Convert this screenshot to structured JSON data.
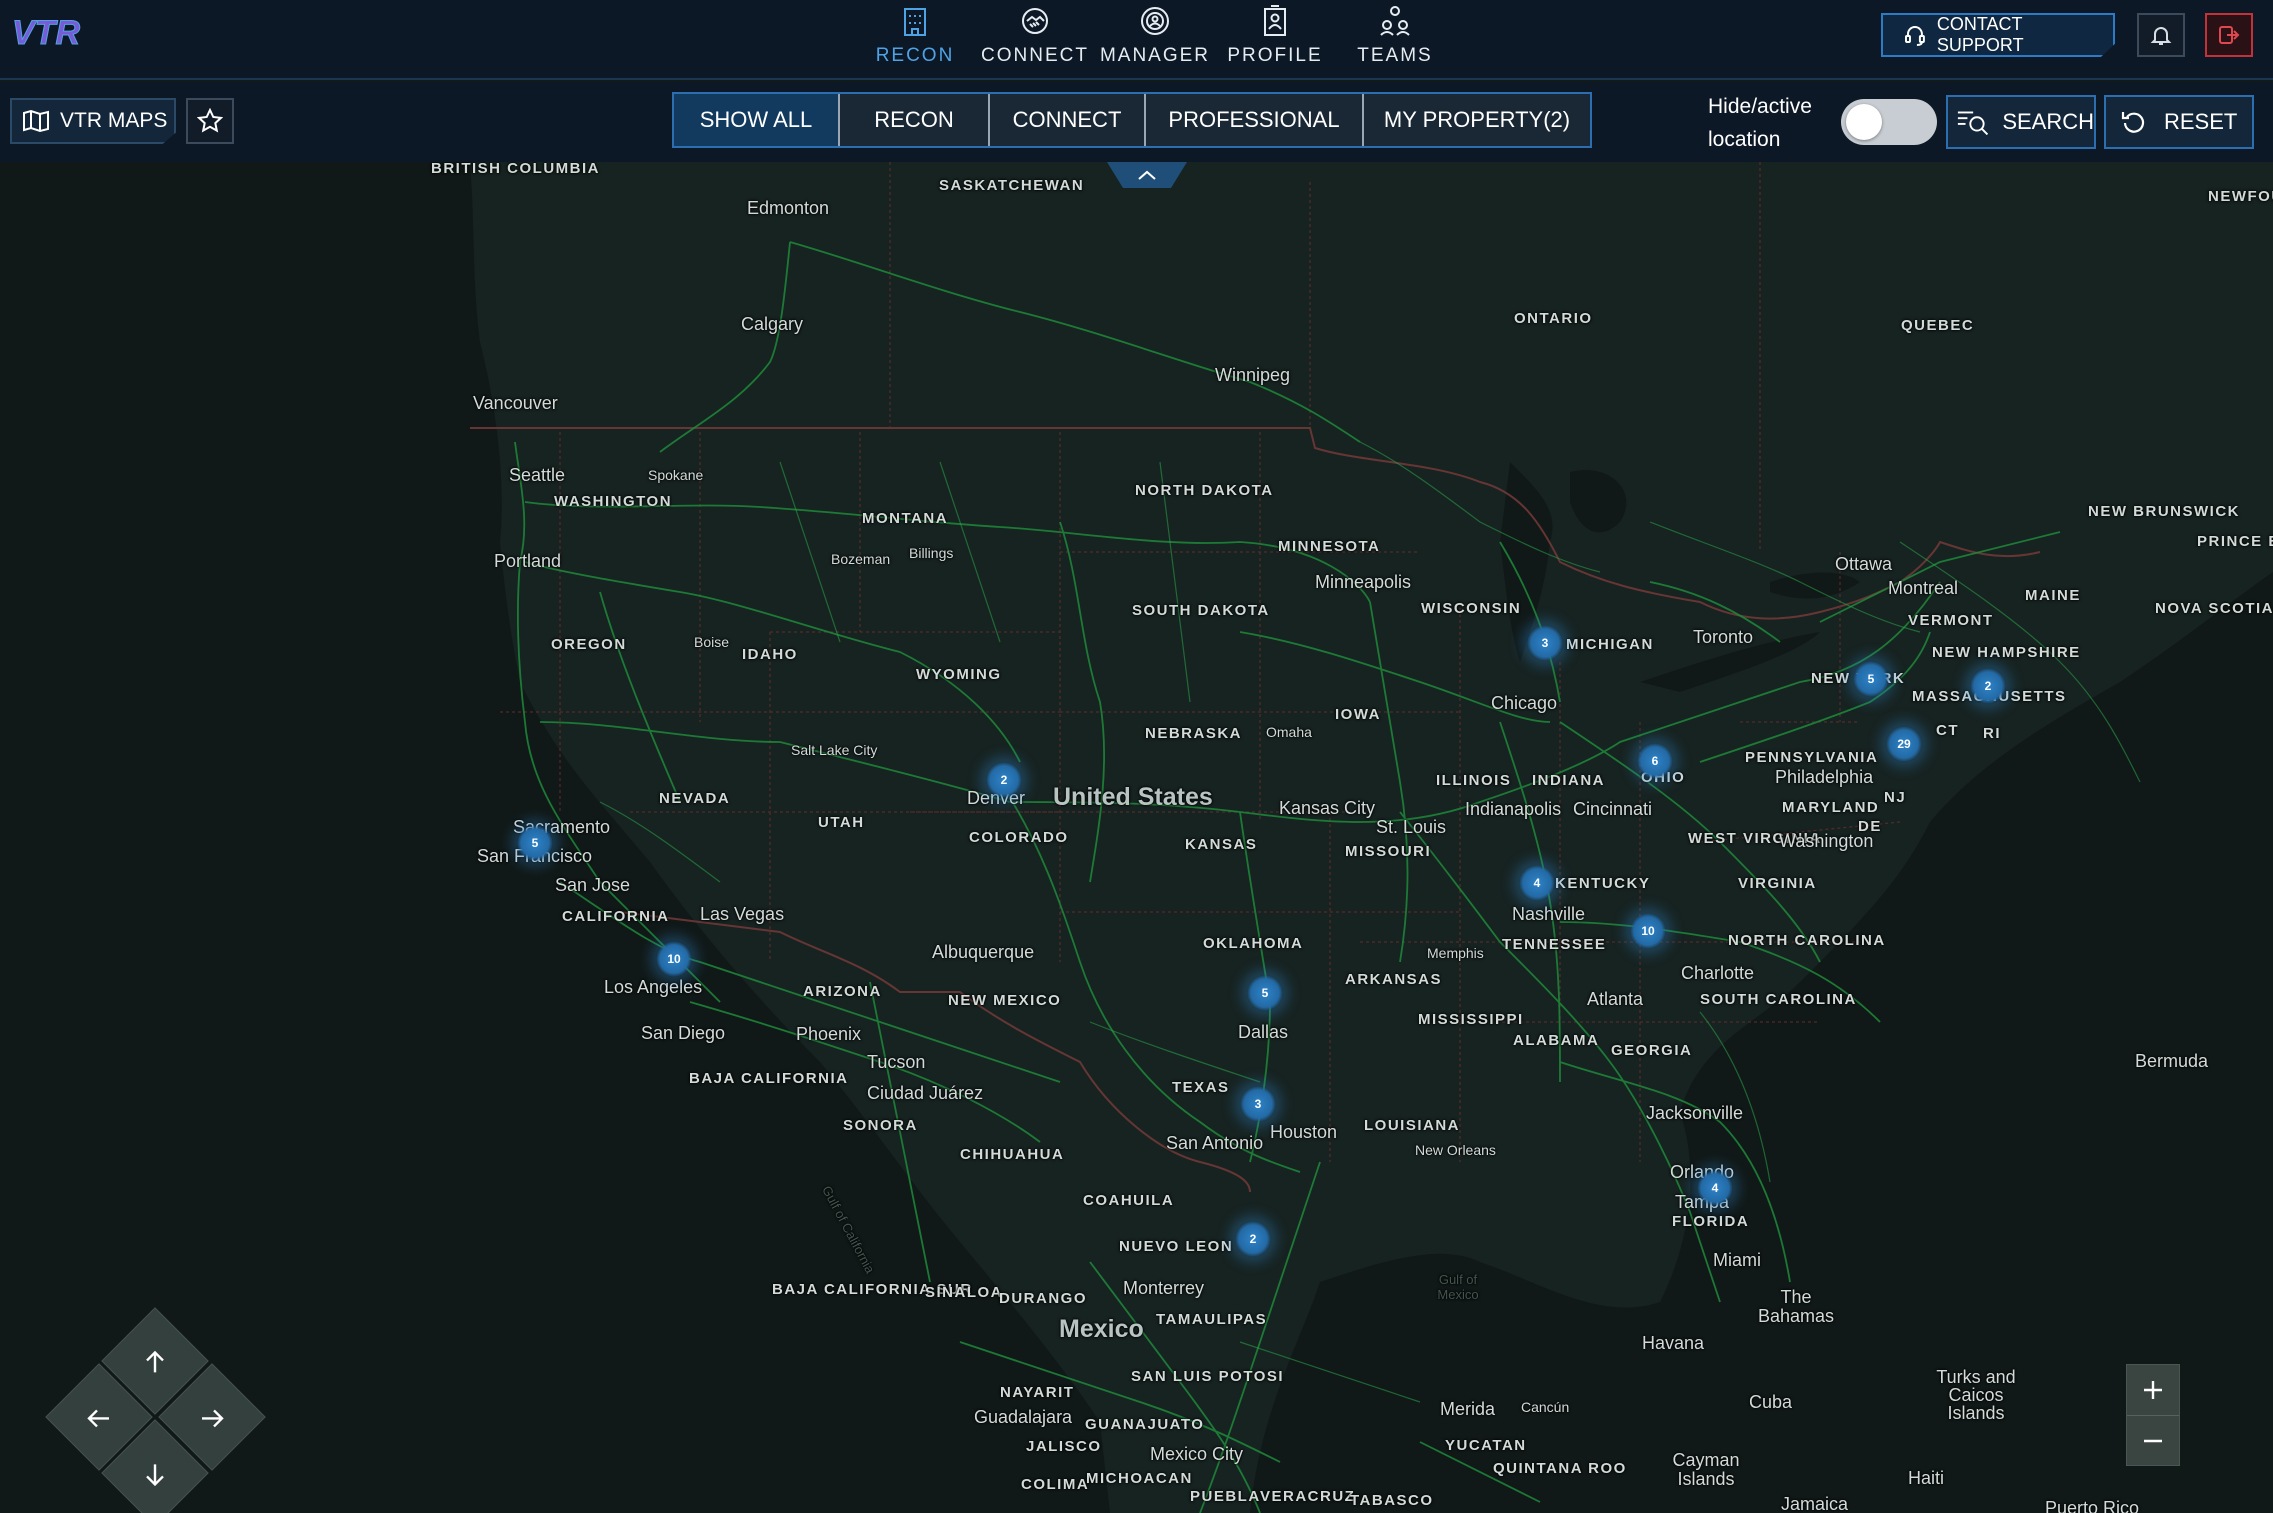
{
  "app": {
    "logo_text": "VTR"
  },
  "topnav": {
    "items": [
      {
        "label": "RECON",
        "icon": "building-icon",
        "active": true
      },
      {
        "label": "CONNECT",
        "icon": "handshake-icon",
        "active": false
      },
      {
        "label": "MANAGER",
        "icon": "manager-icon",
        "active": false
      },
      {
        "label": "PROFILE",
        "icon": "id-card-icon",
        "active": false
      },
      {
        "label": "TEAMS",
        "icon": "team-icon",
        "active": false
      }
    ],
    "support_label": "CONTACT SUPPORT"
  },
  "subbar": {
    "maps_label": "VTR MAPS",
    "filters": [
      "SHOW ALL",
      "RECON",
      "CONNECT",
      "PROFESSIONAL",
      "MY PROPERTY(2)"
    ],
    "active_filter": "SHOW ALL",
    "hide_location_label": "Hide/active location",
    "hide_location_on": false,
    "search_label": "SEARCH",
    "reset_label": "RESET"
  },
  "map": {
    "countries": [
      "United States",
      "Mexico"
    ],
    "regions": [
      "BRITISH COLUMBIA",
      "SASKATCHEWAN",
      "ONTARIO",
      "QUEBEC",
      "NEWFOUNDLAND AND LABRADOR",
      "WASHINGTON",
      "MONTANA",
      "NORTH DAKOTA",
      "MINNESOTA",
      "OREGON",
      "IDAHO",
      "SOUTH DAKOTA",
      "WYOMING",
      "WISCONSIN",
      "MICHIGAN",
      "NEW YORK",
      "NEW HAMPSHIRE",
      "MASSACHUSETTS",
      "VERMONT",
      "MAINE",
      "NEW BRUNSWICK",
      "PRINCE EDWARD ISLAND",
      "NOVA SCOTIA",
      "IOWA",
      "NEBRASKA",
      "NEVADA",
      "UTAH",
      "COLORADO",
      "KANSAS",
      "MISSOURI",
      "ILLINOIS",
      "INDIANA",
      "OHIO",
      "PENNSYLVANIA",
      "NJ",
      "CT",
      "RI",
      "MARYLAND",
      "DE",
      "WEST VIRGINIA",
      "VIRGINIA",
      "KENTUCKY",
      "CALIFORNIA",
      "ARIZONA",
      "NEW MEXICO",
      "OKLAHOMA",
      "ARKANSAS",
      "TENNESSEE",
      "NORTH CAROLINA",
      "SOUTH CAROLINA",
      "MISSISSIPPI",
      "ALABAMA",
      "GEORGIA",
      "TEXAS",
      "LOUISIANA",
      "FLORIDA",
      "BAJA CALIFORNIA",
      "SONORA",
      "CHIHUAHUA",
      "COAHUILA",
      "NUEVO LEON",
      "BAJA CALIFORNIA SUR",
      "SINALOA",
      "DURANGO",
      "TAMAULIPAS",
      "SAN LUIS POTOSI",
      "NAYARIT",
      "GUANAJUATO",
      "JALISCO",
      "COLIMA",
      "MICHOACAN",
      "PUEBLA",
      "VERACRUZ",
      "TABASCO",
      "YUCATAN",
      "QUINTANA ROO"
    ],
    "cities": [
      "Edmonton",
      "Calgary",
      "Vancouver",
      "Winnipeg",
      "Seattle",
      "Spokane",
      "Portland",
      "Bozeman",
      "Billings",
      "Boise",
      "Minneapolis",
      "Ottawa",
      "Montreal",
      "Toronto",
      "Chicago",
      "Omaha",
      "Salt Lake City",
      "Denver",
      "Kansas City",
      "St. Louis",
      "Indianapolis",
      "Cincinnati",
      "Philadelphia",
      "Washington",
      "Sacramento",
      "San Francisco",
      "San Jose",
      "Las Vegas",
      "Los Angeles",
      "San Diego",
      "Phoenix",
      "Tucson",
      "Albuquerque",
      "Ciudad Juárez",
      "Nashville",
      "Memphis",
      "Charlotte",
      "Atlanta",
      "Dallas",
      "Houston",
      "San Antonio",
      "New Orleans",
      "Jacksonville",
      "Orlando",
      "Tampa",
      "Miami",
      "Monterrey",
      "Guadalajara",
      "Mexico City",
      "Merida",
      "Cancún",
      "Havana",
      "Bermuda",
      "The Bahamas",
      "Cuba",
      "Turks and Caicos Islands",
      "Cayman Islands",
      "Haiti",
      "Jamaica",
      "Puerto Rico"
    ],
    "water_labels": [
      "Gulf of Mexico",
      "Gulf of California"
    ],
    "clusters": [
      {
        "count": "3",
        "place": "Michigan"
      },
      {
        "count": "5",
        "place": "New York"
      },
      {
        "count": "2",
        "place": "Massachusetts"
      },
      {
        "count": "29",
        "place": "New York City"
      },
      {
        "count": "6",
        "place": "Ohio"
      },
      {
        "count": "2",
        "place": "Denver"
      },
      {
        "count": "5",
        "place": "San Francisco"
      },
      {
        "count": "4",
        "place": "Kentucky"
      },
      {
        "count": "10",
        "place": "Tennessee"
      },
      {
        "count": "10",
        "place": "Los Angeles"
      },
      {
        "count": "5",
        "place": "Oklahoma"
      },
      {
        "count": "3",
        "place": "Texas"
      },
      {
        "count": "4",
        "place": "Florida"
      },
      {
        "count": "2",
        "place": "South Texas"
      }
    ]
  },
  "controls": {
    "dpad": [
      "arrow-up-icon",
      "arrow-left-icon",
      "arrow-right-icon",
      "arrow-down-icon"
    ],
    "zoom_in": "+",
    "zoom_out": "−"
  },
  "colors": {
    "accent": "#4da3e6",
    "cluster": "#2e83c8",
    "road": "#1f8a3a",
    "border": "#6d3b3b",
    "danger": "#c2323a"
  }
}
